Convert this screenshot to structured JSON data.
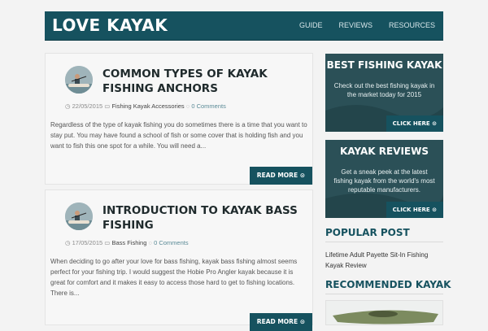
{
  "header": {
    "site_title": "LOVE KAYAK",
    "nav": [
      "GUIDE",
      "REVIEWS",
      "RESOURCES"
    ]
  },
  "posts": [
    {
      "title_line1": "COMMON TYPES OF KAYAK",
      "title_line2": "FISHING ANCHORS",
      "date": "22/05/2015",
      "category": "Fishing Kayak Accessories",
      "comments": "0 Comments",
      "excerpt": "Regardless of the type of kayak fishing you do sometimes there is a time that you want to stay put. You may have found a school of fish or some cover that is holding fish and you want to fish this one spot for a while. You will need a...",
      "read_more": "READ MORE"
    },
    {
      "title_line1": "INTRODUCTION TO KAYAK BASS",
      "title_line2": "FISHING",
      "date": "17/05/2015",
      "category": "Bass Fishing",
      "comments": "0 Comments",
      "excerpt": "When deciding to go after your love for bass fishing, kayak bass fishing almost seems perfect for your fishing trip. I would suggest the Hobie Pro Angler kayak because it is great for comfort and it makes it easy to access those hard to get to fishing locations. There is...",
      "read_more": "READ MORE"
    }
  ],
  "sidebar": {
    "ads": [
      {
        "title": "BEST FISHING KAYAK",
        "text": "Check out the best fishing kayak in the market today for 2015",
        "button": "CLICK HERE"
      },
      {
        "title": "KAYAK REVIEWS",
        "text": "Get a sneak peek at the latest fishing kayak from the world's most reputable manufacturers.",
        "button": "CLICK HERE"
      }
    ],
    "popular_heading": "POPULAR POST",
    "popular_links": [
      "Lifetime Adult Payette Sit-In Fishing Kayak Review"
    ],
    "recommended_heading": "RECOMMENDED KAYAK"
  },
  "colors": {
    "brand": "#16525f",
    "ad_bg": "#2b5057",
    "background": "#f3f3f3"
  },
  "icons": [
    "calendar-icon",
    "folder-icon",
    "comment-icon",
    "circle-arrow-icon"
  ]
}
